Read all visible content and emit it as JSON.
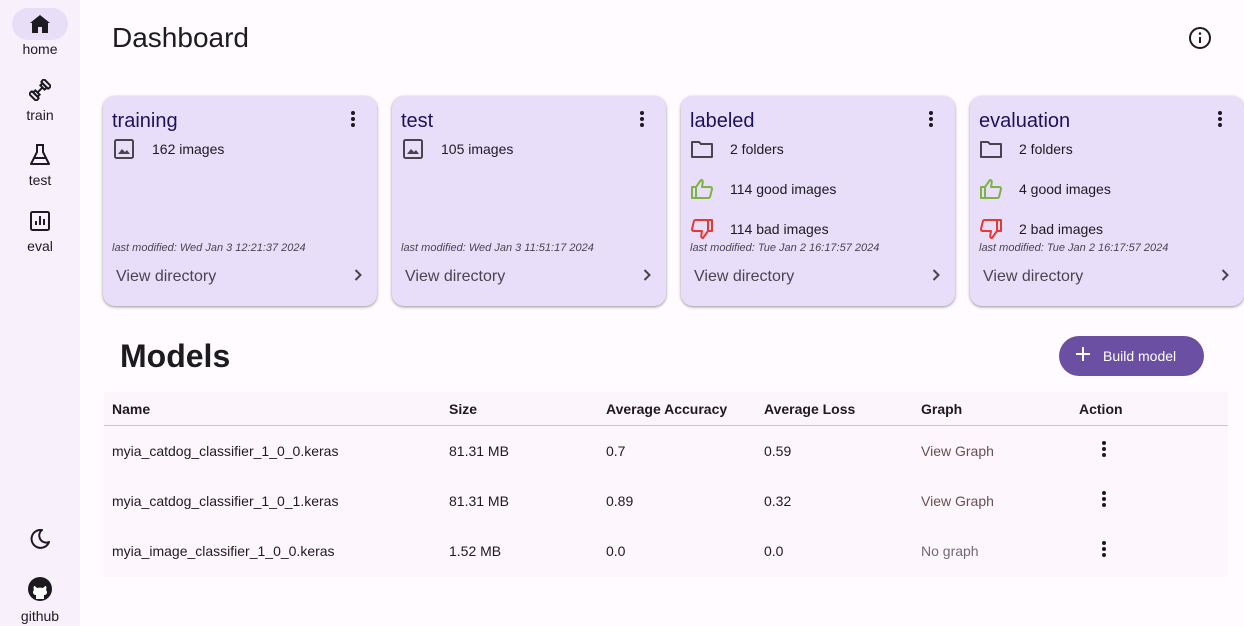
{
  "nav": {
    "items": [
      {
        "label": "home",
        "icon": "home-icon"
      },
      {
        "label": "train",
        "icon": "dumbbell-icon"
      },
      {
        "label": "test",
        "icon": "flask-icon"
      },
      {
        "label": "eval",
        "icon": "bar-chart-icon"
      }
    ],
    "github_label": "github"
  },
  "header": {
    "title": "Dashboard"
  },
  "cards": [
    {
      "title": "training",
      "images": "162 images",
      "modified": "last modified: Wed Jan 3 12:21:37 2024",
      "link": "View directory"
    },
    {
      "title": "test",
      "images": "105 images",
      "modified": "last modified: Wed Jan 3 11:51:17 2024",
      "link": "View directory"
    },
    {
      "title": "labeled",
      "folders": "2 folders",
      "good": "114 good images",
      "bad": "114 bad images",
      "modified": "last modified: Tue Jan 2 16:17:57 2024",
      "link": "View directory"
    },
    {
      "title": "evaluation",
      "folders": "2 folders",
      "good": "4 good images",
      "bad": "2 bad images",
      "modified": "last modified: Tue Jan 2 16:17:57 2024",
      "link": "View directory"
    }
  ],
  "models": {
    "title": "Models",
    "build_label": "Build model",
    "columns": [
      "Name",
      "Size",
      "Average Accuracy",
      "Average Loss",
      "Graph",
      "Action"
    ],
    "rows": [
      {
        "name": "myia_catdog_classifier_1_0_0.keras",
        "size": "81.31 MB",
        "accuracy": "0.7",
        "loss": "0.59",
        "graph": "View Graph"
      },
      {
        "name": "myia_catdog_classifier_1_0_1.keras",
        "size": "81.31 MB",
        "accuracy": "0.89",
        "loss": "0.32",
        "graph": "View Graph"
      },
      {
        "name": "myia_image_classifier_1_0_0.keras",
        "size": "1.52 MB",
        "accuracy": "0.0",
        "loss": "0.0",
        "graph": "No graph"
      }
    ]
  },
  "colors": {
    "primary": "#6a4fa3",
    "card_bg": "#e8defa",
    "good": "#7cb342",
    "bad": "#e53935"
  }
}
